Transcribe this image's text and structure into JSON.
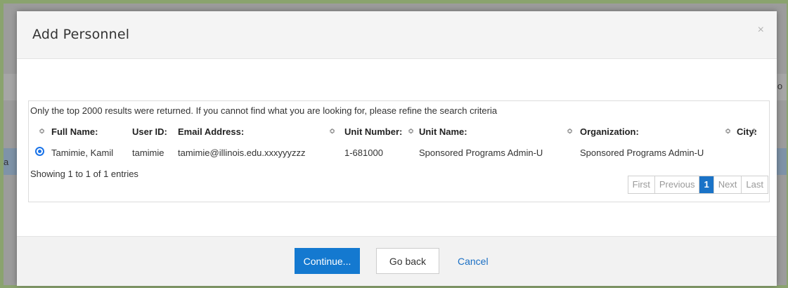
{
  "background": {
    "right_fragment": "io",
    "left_fragment": "a"
  },
  "modal": {
    "title": "Add Personnel",
    "close_icon": "×",
    "notice": "Only the top 2000 results were returned. If you cannot find what you are looking for, please refine the search criteria",
    "columns": [
      "Full Name:",
      "User ID:",
      "Email Address:",
      "Unit Number:",
      "Unit Name:",
      "Organization:",
      "City:"
    ],
    "sort_icon": "≎",
    "rows": [
      {
        "selected": true,
        "full_name": "Tamimie, Kamil",
        "user_id": "tamimie",
        "email": "tamimie@illinois.edu.xxxyyyzzz",
        "unit_number": "1-681000",
        "unit_name": "Sponsored Programs Admin-U",
        "organization": "Sponsored Programs Admin-U",
        "city": ""
      }
    ],
    "showing": "Showing 1 to 1 of 1 entries",
    "pagination": {
      "first": "First",
      "previous": "Previous",
      "current": "1",
      "next": "Next",
      "last": "Last"
    },
    "footer": {
      "continue": "Continue...",
      "go_back": "Go back",
      "cancel": "Cancel"
    }
  },
  "colors": {
    "primary": "#1479d0",
    "link": "#1a6fc4",
    "active_page": "#1a73c7",
    "frame": "#8aa36e"
  }
}
